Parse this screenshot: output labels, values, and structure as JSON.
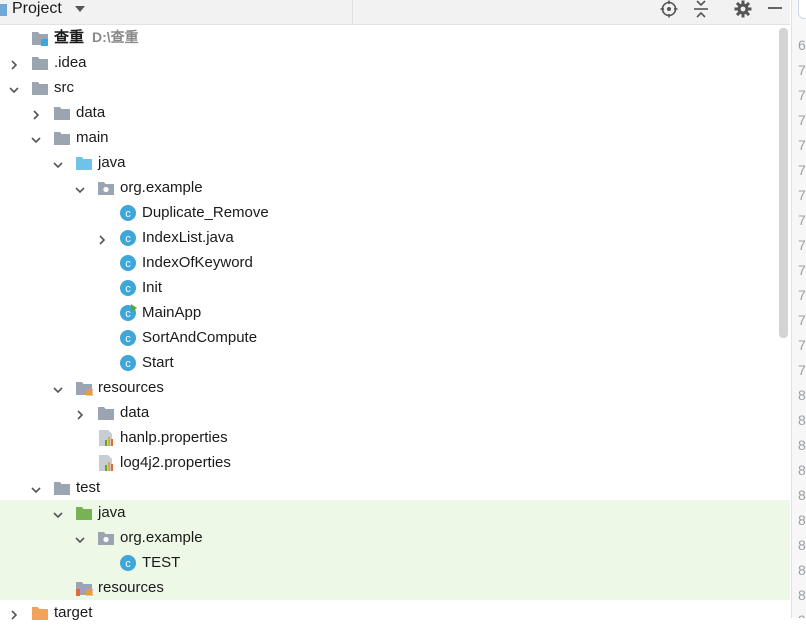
{
  "header": {
    "title": "Project",
    "toolbar_icons": [
      "locate-icon",
      "collapse-icon",
      "settings-icon",
      "minimize-icon"
    ]
  },
  "tree": [
    {
      "label": "查重",
      "path": "D:\\查重",
      "depth": 0,
      "arrow": "none",
      "icon": "module",
      "bold": true
    },
    {
      "label": ".idea",
      "depth": 0,
      "arrow": "right",
      "icon": "folder-gray"
    },
    {
      "label": "src",
      "depth": 0,
      "arrow": "down",
      "icon": "folder-gray"
    },
    {
      "label": "data",
      "depth": 1,
      "arrow": "right",
      "icon": "folder-gray"
    },
    {
      "label": "main",
      "depth": 1,
      "arrow": "down",
      "icon": "folder-gray"
    },
    {
      "label": "java",
      "depth": 2,
      "arrow": "down",
      "icon": "folder-blue"
    },
    {
      "label": "org.example",
      "depth": 3,
      "arrow": "down",
      "icon": "package"
    },
    {
      "label": "Duplicate_Remove",
      "depth": 4,
      "arrow": "none",
      "icon": "class"
    },
    {
      "label": "IndexList.java",
      "depth": 4,
      "arrow": "right",
      "icon": "class"
    },
    {
      "label": "IndexOfKeyword",
      "depth": 4,
      "arrow": "none",
      "icon": "class"
    },
    {
      "label": "Init",
      "depth": 4,
      "arrow": "none",
      "icon": "class"
    },
    {
      "label": "MainApp",
      "depth": 4,
      "arrow": "none",
      "icon": "class-run"
    },
    {
      "label": "SortAndCompute",
      "depth": 4,
      "arrow": "none",
      "icon": "class"
    },
    {
      "label": "Start",
      "depth": 4,
      "arrow": "none",
      "icon": "class"
    },
    {
      "label": "resources",
      "depth": 2,
      "arrow": "down",
      "icon": "folder-resources"
    },
    {
      "label": "data",
      "depth": 3,
      "arrow": "right",
      "icon": "folder-gray"
    },
    {
      "label": "hanlp.properties",
      "depth": 3,
      "arrow": "none",
      "icon": "properties"
    },
    {
      "label": "log4j2.properties",
      "depth": 3,
      "arrow": "none",
      "icon": "properties"
    },
    {
      "label": "test",
      "depth": 1,
      "arrow": "down",
      "icon": "folder-gray"
    },
    {
      "label": "java",
      "depth": 2,
      "arrow": "down",
      "icon": "folder-green",
      "test": true
    },
    {
      "label": "org.example",
      "depth": 3,
      "arrow": "down",
      "icon": "package",
      "test": true
    },
    {
      "label": "TEST",
      "depth": 4,
      "arrow": "none",
      "icon": "class",
      "test": true
    },
    {
      "label": "resources",
      "depth": 2,
      "arrow": "none",
      "icon": "folder-test-resources",
      "test": true
    },
    {
      "label": "target",
      "depth": 0,
      "arrow": "right",
      "icon": "folder-orange"
    }
  ],
  "gutter_numbers": [
    "6",
    "7",
    "7",
    "7",
    "7",
    "7",
    "7",
    "7",
    "7",
    "7",
    "7",
    "7",
    "7",
    "7",
    "8",
    "8",
    "8",
    "8",
    "8",
    "8",
    "8",
    "8",
    "8",
    "9"
  ],
  "colors": {
    "folder_gray": "#9aa5b1",
    "folder_blue": "#6fc2e8",
    "folder_green": "#77b255",
    "folder_orange": "#f2a25b",
    "class_icon": "#3fa6d9",
    "test_bg": "#eef8e6"
  }
}
